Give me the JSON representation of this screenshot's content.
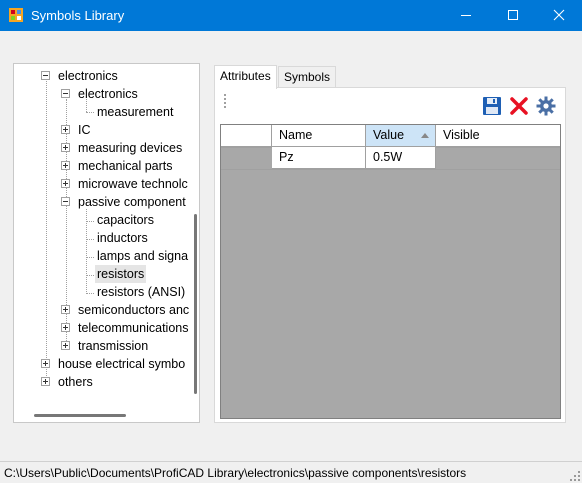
{
  "window": {
    "title": "Symbols Library",
    "minimize_icon": "minimize-icon",
    "maximize_icon": "maximize-icon",
    "close_icon": "close-icon"
  },
  "tree": {
    "items": [
      {
        "label": "electronics",
        "state": "expanded"
      },
      {
        "label": "electronics",
        "state": "expanded"
      },
      {
        "label": "measurement",
        "state": "leaf"
      },
      {
        "label": "IC",
        "state": "collapsed"
      },
      {
        "label": "measuring devices",
        "state": "collapsed"
      },
      {
        "label": "mechanical parts",
        "state": "collapsed"
      },
      {
        "label": "microwave technolc",
        "state": "collapsed"
      },
      {
        "label": "passive component",
        "state": "expanded"
      },
      {
        "label": "capacitors",
        "state": "leaf"
      },
      {
        "label": "inductors",
        "state": "leaf"
      },
      {
        "label": "lamps and signa",
        "state": "leaf"
      },
      {
        "label": "resistors",
        "state": "leaf",
        "selected": true
      },
      {
        "label": "resistors (ANSI)",
        "state": "leaf"
      },
      {
        "label": "semiconductors anc",
        "state": "collapsed"
      },
      {
        "label": "telecommunications",
        "state": "collapsed"
      },
      {
        "label": "transmission",
        "state": "collapsed"
      },
      {
        "label": "house electrical symbo",
        "state": "collapsed"
      },
      {
        "label": "others",
        "state": "collapsed"
      }
    ]
  },
  "tabs": [
    {
      "label": "Attributes",
      "active": true
    },
    {
      "label": "Symbols",
      "active": false
    }
  ],
  "toolbar": {
    "save_icon": "save-icon",
    "delete_icon": "delete-icon",
    "settings_icon": "gear-icon"
  },
  "grid": {
    "columns": [
      "Name",
      "Value",
      "Visible"
    ],
    "sorted_column": "Value",
    "rows": [
      {
        "name": "Pz",
        "value": "0.5W",
        "visible": false
      },
      {
        "name": "",
        "value": "",
        "visible": false,
        "new_row": true
      }
    ]
  },
  "status": {
    "path": "C:\\Users\\Public\\Documents\\ProfiCAD Library\\electronics\\passive components\\resistors"
  },
  "colors": {
    "titlebar": "#0078d7",
    "selection": "#0078d7",
    "delete_red": "#e81123",
    "save_blue": "#1e5fb4"
  }
}
